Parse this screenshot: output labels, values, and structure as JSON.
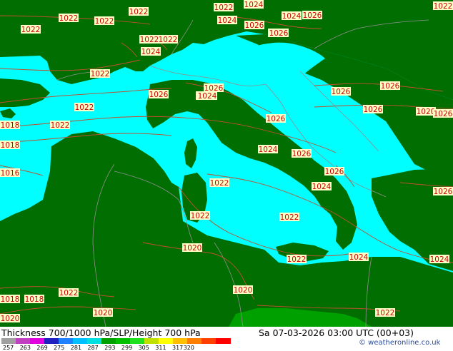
{
  "title": "Thickness 700/1000 hPa/SLP/Height 700 hPa",
  "valid_time": "Sa 07-03-2026 03:00 UTC (00+03)",
  "credit": "© weatheronline.co.uk",
  "colors": {
    "land": "#006e00",
    "sea": "#00ffff",
    "isobar": "#c05030",
    "border": "#909090",
    "label_bg": "#ffffc8",
    "label_text": "#cc0000",
    "highland": "#00a000"
  },
  "scale": {
    "ticks": [
      "257",
      "263",
      "269",
      "275",
      "281",
      "287",
      "293",
      "299",
      "305",
      "311",
      "317",
      "320"
    ],
    "colors": [
      "#a0a0a0",
      "#c040c0",
      "#e000e0",
      "#2020c0",
      "#2080ff",
      "#00c0ff",
      "#00e0e0",
      "#00a000",
      "#00c000",
      "#20e020",
      "#c0e000",
      "#ffff00",
      "#ffc000",
      "#ff8000",
      "#ff4000",
      "#ff0000"
    ]
  },
  "isobar_labels": [
    "1022",
    "1022",
    "1022",
    "1022",
    "1024",
    "1024",
    "1026",
    "1026",
    "1022",
    "1022",
    "1022",
    "1022",
    "1024",
    "1024",
    "1026",
    "1022",
    "1026",
    "1026",
    "1024",
    "1026",
    "1026",
    "1026",
    "1022",
    "1026",
    "1026",
    "1026",
    "1020",
    "1018",
    "1018",
    "1016",
    "1024",
    "1026",
    "1026",
    "1024",
    "1022",
    "1022",
    "1022",
    "1022",
    "1020",
    "1024",
    "1022",
    "1024",
    "1020",
    "1018",
    "1018",
    "1020",
    "1020",
    "1022",
    "1022",
    "1026",
    "1024"
  ]
}
